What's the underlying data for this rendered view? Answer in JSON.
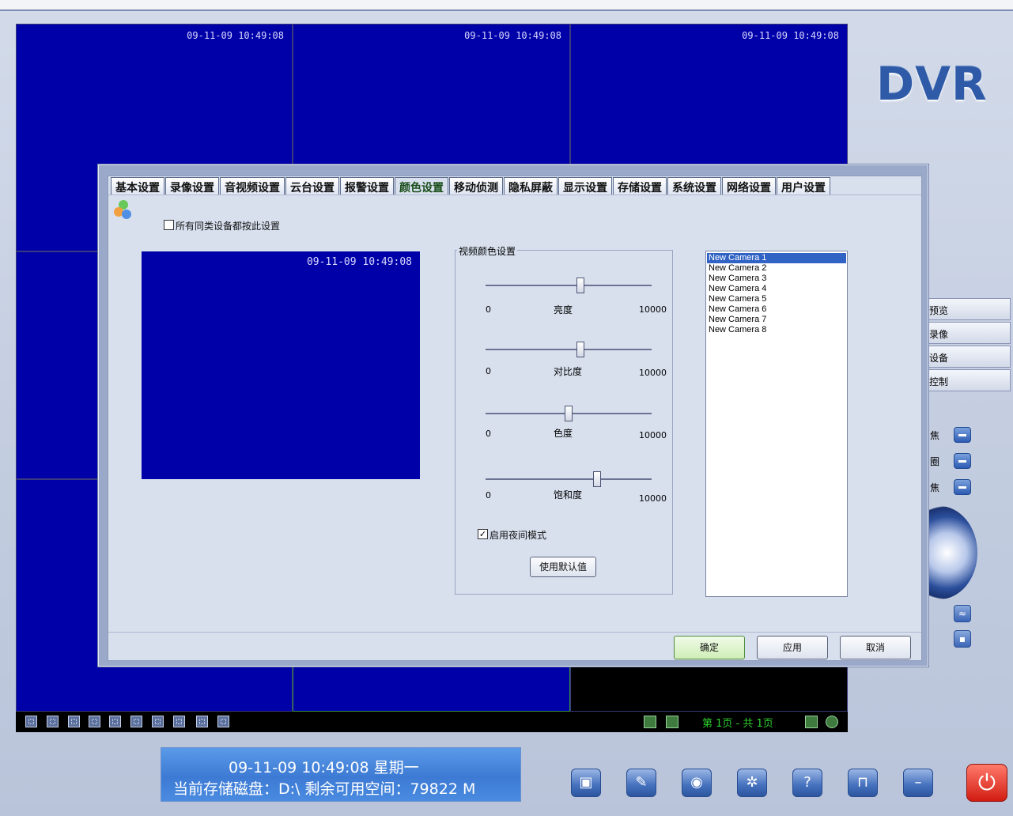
{
  "logo": "DVR",
  "video_wall": {
    "timestamps": [
      "09-11-09 10:49:08",
      "09-11-09 10:49:08",
      "09-11-09 10:49:08"
    ]
  },
  "pager": {
    "text": "第 1页 - 共 1页"
  },
  "side_menu": [
    "预览",
    "录像",
    "设备",
    "控制"
  ],
  "ptz_labels": [
    "焦",
    "圈",
    "焦"
  ],
  "status": {
    "datetime": "09-11-09  10:49:08    星期一",
    "disk": "当前存储磁盘：D:\\    剩余可用空间：79822 M"
  },
  "dialog": {
    "tabs": [
      "基本设置",
      "录像设置",
      "音视频设置",
      "云台设置",
      "报警设置",
      "颜色设置",
      "移动侦测",
      "隐私屏蔽",
      "显示设置",
      "存储设置",
      "系统设置",
      "网络设置",
      "用户设置"
    ],
    "active_tab": "颜色设置",
    "apply_all_label": "所有同类设备都按此设置",
    "preview_timestamp": "09-11-09 10:49:08",
    "group_title": "视频颜色设置",
    "sliders": [
      {
        "name": "亮度",
        "min": "0",
        "max": "10000",
        "value": 0.57
      },
      {
        "name": "对比度",
        "min": "0",
        "max": "10000",
        "value": 0.57
      },
      {
        "name": "色度",
        "min": "0",
        "max": "10000",
        "value": 0.5
      },
      {
        "name": "饱和度",
        "min": "0",
        "max": "10000",
        "value": 0.67
      }
    ],
    "night_mode_label": "启用夜间模式",
    "night_mode_checked": true,
    "default_button": "使用默认值",
    "cameras": [
      "New Camera 1",
      "New Camera 2",
      "New Camera 3",
      "New Camera 4",
      "New Camera 5",
      "New Camera 6",
      "New Camera 7",
      "New Camera 8"
    ],
    "selected_camera": "New Camera 1",
    "ok_button": "确定",
    "apply_button": "应用",
    "cancel_button": "取消"
  },
  "colors": {
    "video_blue": "#0000a8",
    "pager_green": "#2ed12e",
    "status_blue": "#3d7ad4"
  }
}
